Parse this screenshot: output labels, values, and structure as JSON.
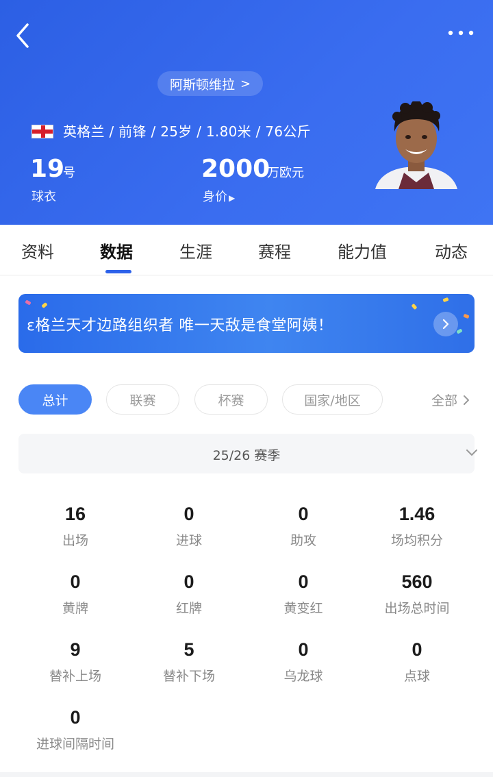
{
  "header": {
    "team_label": "阿斯顿维拉",
    "team_chevron": ">",
    "info_line": "英格兰 / 前锋 / 25岁 / 1.80米 / 76公斤",
    "shirt_number": "19",
    "shirt_unit": "号",
    "shirt_label": "球衣",
    "market_value": "2000",
    "market_value_unit": "万欧元",
    "market_value_label": "身价",
    "header_color": "#3166e8"
  },
  "tabs": [
    {
      "label": "资料",
      "active": false
    },
    {
      "label": "数据",
      "active": true
    },
    {
      "label": "生涯",
      "active": false
    },
    {
      "label": "赛程",
      "active": false
    },
    {
      "label": "能力值",
      "active": false
    },
    {
      "label": "动态",
      "active": false
    }
  ],
  "banner": {
    "text": "ε格兰天才边路组织者 唯一天敌是食堂阿姨！"
  },
  "filters": [
    {
      "label": "总计",
      "active": true
    },
    {
      "label": "联赛",
      "active": false
    },
    {
      "label": "杯赛",
      "active": false
    },
    {
      "label": "国家/地区",
      "active": false
    }
  ],
  "filter_all": "全部",
  "season": {
    "label": "25/26 赛季"
  },
  "stats": [
    {
      "value": "16",
      "label": "出场"
    },
    {
      "value": "0",
      "label": "进球"
    },
    {
      "value": "0",
      "label": "助攻"
    },
    {
      "value": "1.46",
      "label": "场均积分"
    },
    {
      "value": "0",
      "label": "黄牌"
    },
    {
      "value": "0",
      "label": "红牌"
    },
    {
      "value": "0",
      "label": "黄变红"
    },
    {
      "value": "560",
      "label": "出场总时间"
    },
    {
      "value": "9",
      "label": "替补上场"
    },
    {
      "value": "5",
      "label": "替补下场"
    },
    {
      "value": "0",
      "label": "乌龙球"
    },
    {
      "value": "0",
      "label": "点球"
    },
    {
      "value": "0",
      "label": "进球间隔时间"
    }
  ],
  "colors": {
    "accent": "#2d62ea",
    "active_filter": "#4a86f5",
    "flag_red": "#d61f2b"
  }
}
